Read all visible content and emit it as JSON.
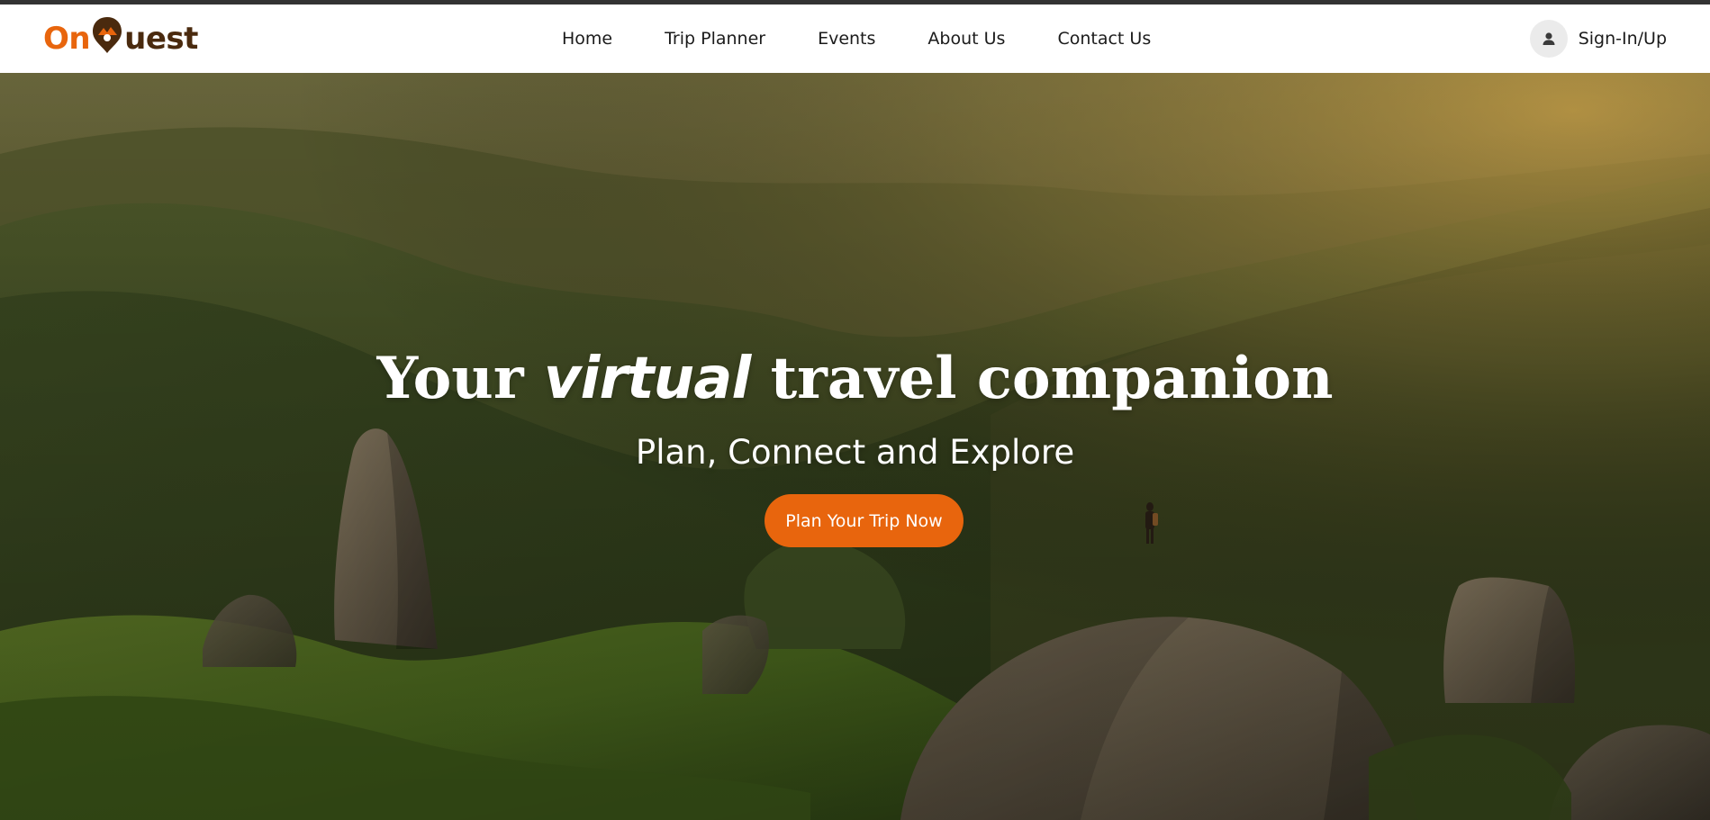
{
  "brand": {
    "logo_prefix": "On",
    "logo_suffix": "uest",
    "accent_color": "#e8650d",
    "secondary_color": "#4a2a0e"
  },
  "nav": {
    "items": [
      {
        "label": "Home"
      },
      {
        "label": "Trip Planner"
      },
      {
        "label": "Events"
      },
      {
        "label": "About Us"
      },
      {
        "label": "Contact Us"
      }
    ],
    "signin_label": "Sign-In/Up",
    "avatar_icon": "user-icon"
  },
  "hero": {
    "headline_before": "Your",
    "headline_emphasis": "virtual",
    "headline_after": "travel companion",
    "subheadline": "Plan, Connect and Explore",
    "cta_label": "Plan Your Trip Now",
    "background": "mountain-landscape-photo"
  }
}
